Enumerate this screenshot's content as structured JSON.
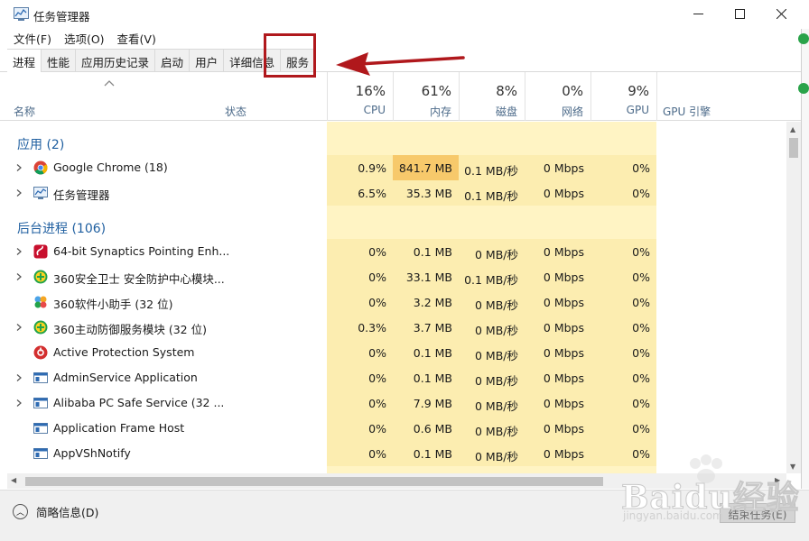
{
  "window": {
    "title": "任务管理器"
  },
  "menu": [
    "文件(F)",
    "选项(O)",
    "查看(V)"
  ],
  "tabs": [
    "进程",
    "性能",
    "应用历史记录",
    "启动",
    "用户",
    "详细信息",
    "服务"
  ],
  "active_tab": "进程",
  "columns": {
    "name": "名称",
    "status": "状态",
    "cpu": {
      "pct": "16%",
      "label": "CPU"
    },
    "memory": {
      "pct": "61%",
      "label": "内存"
    },
    "disk": {
      "pct": "8%",
      "label": "磁盘"
    },
    "network": {
      "pct": "0%",
      "label": "网络"
    },
    "gpu": {
      "pct": "9%",
      "label": "GPU"
    },
    "gpu_engine": "GPU 引擎"
  },
  "groups": {
    "apps": "应用 (2)",
    "background": "后台进程 (106)"
  },
  "apps": [
    {
      "name": "Google Chrome (18)",
      "icon": "chrome-icon",
      "expandable": true,
      "cpu": "0.9%",
      "mem": "841.7 MB",
      "disk": "0.1 MB/秒",
      "net": "0 Mbps",
      "gpu": "0%",
      "mem_highlight": "#f7c96b"
    },
    {
      "name": "任务管理器",
      "icon": "task-manager-icon",
      "expandable": true,
      "cpu": "6.5%",
      "mem": "35.3 MB",
      "disk": "0.1 MB/秒",
      "net": "0 Mbps",
      "gpu": "0%"
    }
  ],
  "background": [
    {
      "name": "64-bit Synaptics Pointing Enh...",
      "icon": "synaptics-icon",
      "expandable": true,
      "cpu": "0%",
      "mem": "0.1 MB",
      "disk": "0 MB/秒",
      "net": "0 Mbps",
      "gpu": "0%"
    },
    {
      "name": "360安全卫士 安全防护中心模块...",
      "icon": "360-plus-icon",
      "expandable": true,
      "cpu": "0%",
      "mem": "33.1 MB",
      "disk": "0.1 MB/秒",
      "net": "0 Mbps",
      "gpu": "0%"
    },
    {
      "name": "360软件小助手 (32 位)",
      "icon": "360-helper-icon",
      "expandable": false,
      "cpu": "0%",
      "mem": "3.2 MB",
      "disk": "0 MB/秒",
      "net": "0 Mbps",
      "gpu": "0%"
    },
    {
      "name": "360主动防御服务模块 (32 位)",
      "icon": "360-plus-icon",
      "expandable": true,
      "cpu": "0.3%",
      "mem": "3.7 MB",
      "disk": "0 MB/秒",
      "net": "0 Mbps",
      "gpu": "0%"
    },
    {
      "name": "Active Protection System",
      "icon": "aps-icon",
      "expandable": false,
      "cpu": "0%",
      "mem": "0.1 MB",
      "disk": "0 MB/秒",
      "net": "0 Mbps",
      "gpu": "0%"
    },
    {
      "name": "AdminService Application",
      "icon": "app-window-icon",
      "expandable": true,
      "cpu": "0%",
      "mem": "0.1 MB",
      "disk": "0 MB/秒",
      "net": "0 Mbps",
      "gpu": "0%"
    },
    {
      "name": "Alibaba PC Safe Service (32 ...",
      "icon": "app-window-icon",
      "expandable": true,
      "cpu": "0%",
      "mem": "7.9 MB",
      "disk": "0 MB/秒",
      "net": "0 Mbps",
      "gpu": "0%"
    },
    {
      "name": "Application Frame Host",
      "icon": "app-window-icon",
      "expandable": false,
      "cpu": "0%",
      "mem": "0.6 MB",
      "disk": "0 MB/秒",
      "net": "0 Mbps",
      "gpu": "0%"
    },
    {
      "name": "AppVShNotify",
      "icon": "app-window-icon",
      "expandable": false,
      "cpu": "0%",
      "mem": "0.1 MB",
      "disk": "0 MB/秒",
      "net": "0 Mbps",
      "gpu": "0%"
    }
  ],
  "footer": {
    "fewer_details": "简略信息(D)",
    "end_task": "结束任务(E)"
  },
  "watermark": {
    "brand": "Baidu经验",
    "url": "jingyan.baidu.com"
  },
  "colors": {
    "heat_light": "#fff4c4",
    "heat_row": "#fcedb0",
    "group_title": "#1f5fa0",
    "annotation": "#b0181c"
  }
}
